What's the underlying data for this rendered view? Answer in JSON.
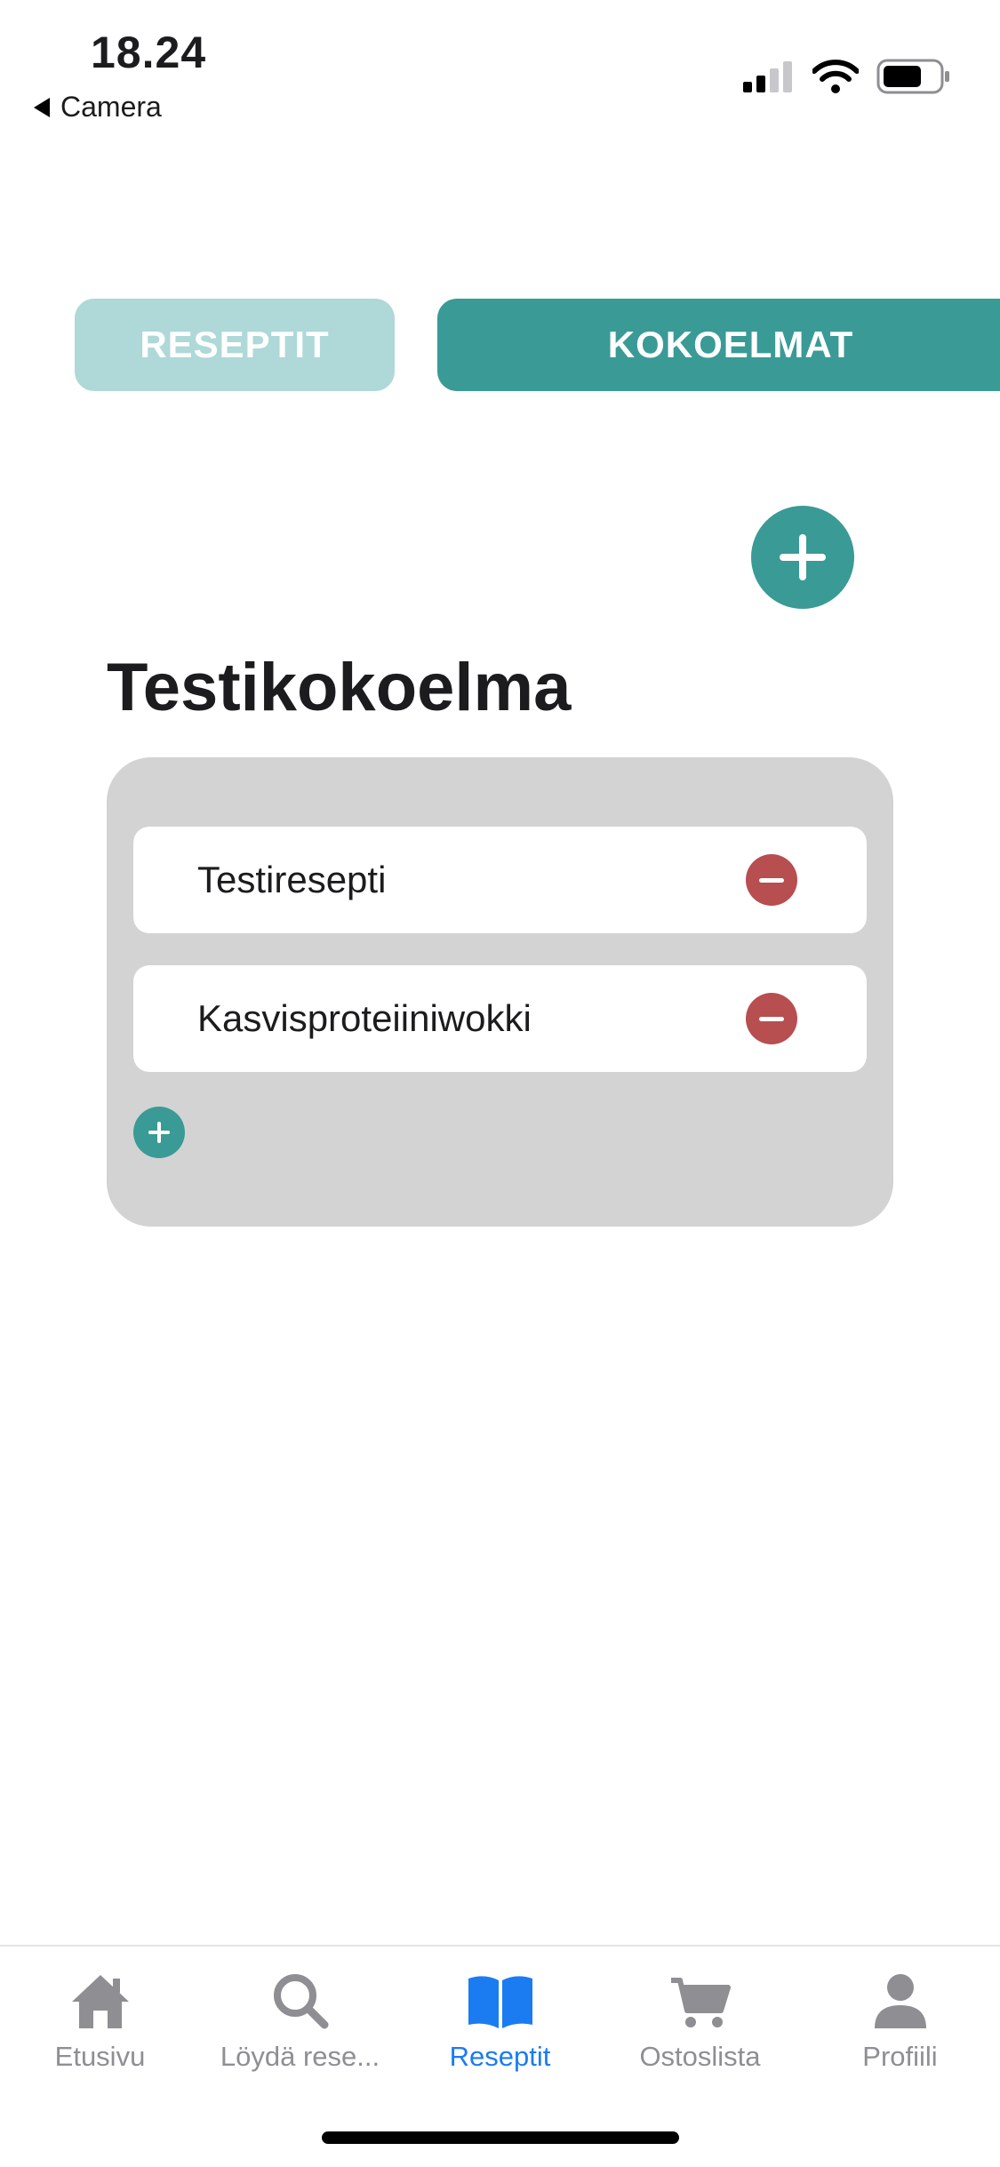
{
  "status": {
    "time": "18.24",
    "back_label": "Camera"
  },
  "segments": {
    "recipes": "RESEPTIT",
    "collections": "KOKOELMAT",
    "active": "collections"
  },
  "collection": {
    "title": "Testikokoelma",
    "recipes": [
      {
        "name": "Testiresepti"
      },
      {
        "name": "Kasvisproteiiniwokki"
      }
    ]
  },
  "tabbar": {
    "active_index": 2,
    "items": [
      {
        "label": "Etusivu",
        "icon": "home-icon"
      },
      {
        "label": "Löydä rese...",
        "icon": "search-icon"
      },
      {
        "label": "Reseptit",
        "icon": "book-icon"
      },
      {
        "label": "Ostoslista",
        "icon": "cart-icon"
      },
      {
        "label": "Profiili",
        "icon": "person-icon"
      }
    ]
  },
  "colors": {
    "accent": "#3a9a96",
    "accent_light": "#afd8d8",
    "remove": "#b74e50",
    "tab_active": "#1a7cf0",
    "tab_inactive": "#8e8e93"
  }
}
